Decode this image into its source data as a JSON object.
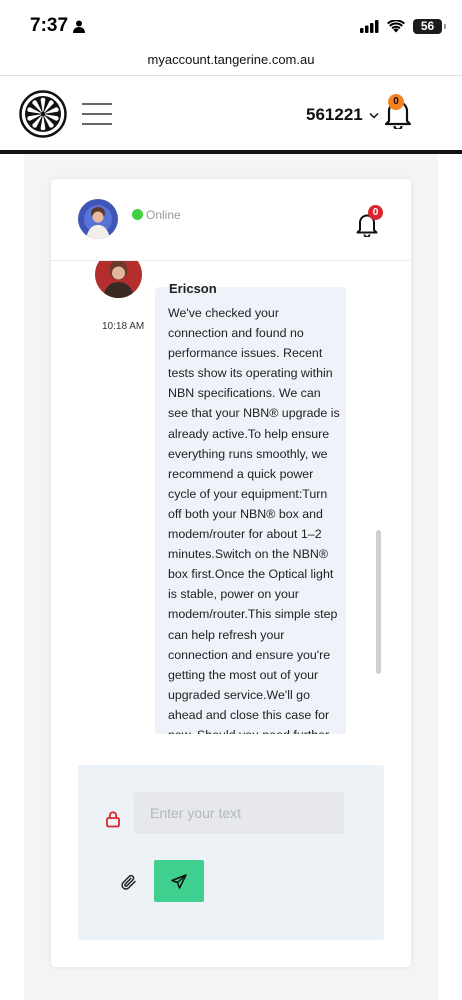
{
  "status_bar": {
    "time": "7:37",
    "battery": "56"
  },
  "browser": {
    "url": "myaccount.tangerine.com.au"
  },
  "header": {
    "account_number": "561221",
    "notification_count": "0"
  },
  "chat": {
    "agent_status": "Online",
    "notification_count": "0",
    "message": {
      "sender": "Ericson",
      "time": "10:18 AM",
      "text": "We've checked your connection and found no performance issues. Recent tests show its operating within NBN specifications. We can see that your NBN® upgrade is already active.To help ensure everything runs smoothly, we recommend a quick power cycle of your equipment:Turn off both your NBN® box and modem/router for about 1–2 minutes.Switch on the NBN® box first.Once the Optical light is stable, power on your modem/router.This simple step can help refresh your connection and ensure you're getting the most out of your upgraded service.We'll go ahead and close this case for now. Should you need further"
    },
    "composer": {
      "placeholder": "Enter your text"
    }
  },
  "icons": {
    "logo": "tangerine-logo-icon",
    "menu": "hamburger-menu-icon",
    "bell": "bell-icon",
    "lock": "lock-icon",
    "attach": "paperclip-icon",
    "send": "send-icon"
  },
  "colors": {
    "online": "#3ed33e",
    "header_badge": "#f58220",
    "card_badge": "#d9262c",
    "send_button": "#3fcf8e",
    "bubble": "#f0f2fa",
    "composer": "#edf2f6"
  }
}
